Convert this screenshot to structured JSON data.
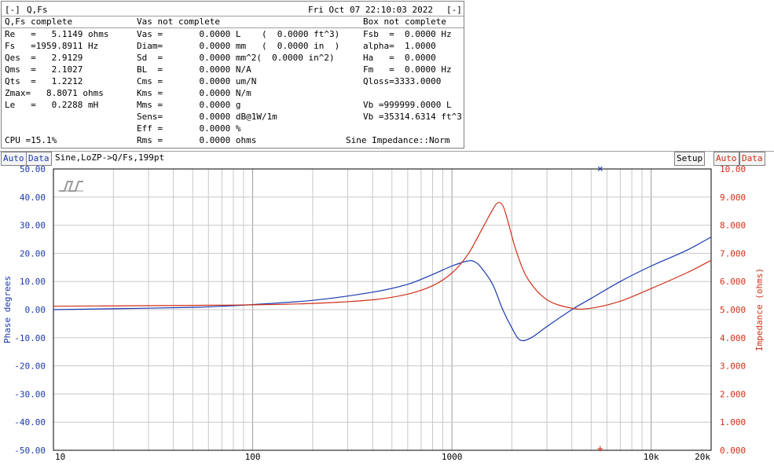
{
  "header": {
    "min_button": "[-]",
    "title": "Q,Fs",
    "datetime": "Fri Oct 07 22:10:03 2022",
    "close_button": "[-]"
  },
  "sections": {
    "qfs": "Q,Fs complete",
    "vas": "Vas not complete",
    "box": "Box not complete"
  },
  "qfs_params": [
    "Re   =   5.1149 ohms",
    "Fs   =1959.8911 Hz",
    "Qes  =   2.9129",
    "Qms  =   2.1027",
    "Qts  =   1.2212",
    "Zmax=   8.8071 ohms",
    "Le   =   0.2288 mH"
  ],
  "vas_params": [
    "Vas =       0.0000 L    (  0.0000 ft^3)",
    "Diam=       0.0000 mm   (  0.0000 in  )",
    "Sd  =       0.0000 mm^2(  0.0000 in^2)",
    "BL  =       0.0000 N/A",
    "Cms =       0.0000 um/N",
    "Kms =       0.0000 N/m",
    "Mms =       0.0000 g",
    "Sens=       0.0000 dB@1W/1m",
    "Eff =       0.0000 %",
    "Rms =       0.0000 ohms"
  ],
  "box_params": [
    "Fsb  =  0.0000 Hz",
    "alpha=  1.0000",
    "Ha   =  0.0000",
    "Fm   =  0.0000 Hz",
    "Qloss=3333.0000",
    "",
    "Vb =999999.0000 L",
    "Vb =35314.6314 ft^3"
  ],
  "cpu": "CPU =15.1%",
  "mode": "Sine Impedance::Norm",
  "toolbar": {
    "left_auto": "Auto",
    "left_data": "Data",
    "curve_title": "Sine,LoZP->Q/Fs,199pt",
    "setup": "Setup",
    "right_auto": "Auto",
    "right_data": "Data"
  },
  "colors": {
    "phase": "#1a3ab0",
    "impedance": "#d03018",
    "grid": "#c8c8c8",
    "frame": "#000000"
  },
  "chart_data": {
    "type": "line",
    "xscale": "log",
    "xlim": [
      10,
      20000
    ],
    "x_ticks": [
      "10",
      "100",
      "1000",
      "10k",
      "20k"
    ],
    "y_left": {
      "label": "Phase degrees",
      "lim": [
        -50,
        50
      ],
      "ticks": [
        "50.00",
        "40.00",
        "30.00",
        "20.00",
        "10.00",
        "0.00",
        "-10.00",
        "-20.00",
        "-30.00",
        "-40.00",
        "-50.00"
      ]
    },
    "y_right": {
      "label": "Impedance (ohms)",
      "lim": [
        0,
        10
      ],
      "ticks": [
        "10.00",
        "9.000",
        "8.000",
        "7.000",
        "6.000",
        "5.000",
        "4.000",
        "3.000",
        "2.000",
        "1.000",
        "0.000"
      ]
    },
    "series": [
      {
        "name": "Phase degrees",
        "axis": "left",
        "x": [
          10,
          20,
          50,
          70,
          100,
          200,
          400,
          600,
          800,
          1000,
          1200,
          1300,
          1400,
          1600,
          1800,
          2000,
          2200,
          2500,
          3000,
          4000,
          5000,
          7000,
          10000,
          15000,
          20000
        ],
        "y": [
          0,
          0.3,
          0.8,
          1.2,
          1.8,
          3.3,
          6.2,
          9,
          12.5,
          15.5,
          17.3,
          17,
          15,
          9,
          0,
          -6.5,
          -10.8,
          -10,
          -6,
          0,
          4,
          10,
          15.5,
          21,
          25.8
        ]
      },
      {
        "name": "Impedance (ohms)",
        "axis": "right",
        "x": [
          10,
          50,
          100,
          200,
          400,
          600,
          800,
          1000,
          1200,
          1400,
          1600,
          1700,
          1800,
          1900,
          2100,
          2400,
          3000,
          4000,
          5000,
          7000,
          10000,
          15000,
          20000
        ],
        "y": [
          5.12,
          5.15,
          5.17,
          5.22,
          5.35,
          5.55,
          5.85,
          6.3,
          6.95,
          7.8,
          8.55,
          8.8,
          8.7,
          8.2,
          7.1,
          6.1,
          5.35,
          5.05,
          5.05,
          5.3,
          5.75,
          6.3,
          6.75
        ]
      }
    ],
    "markers": [
      "×",
      "+"
    ],
    "grid": true
  }
}
